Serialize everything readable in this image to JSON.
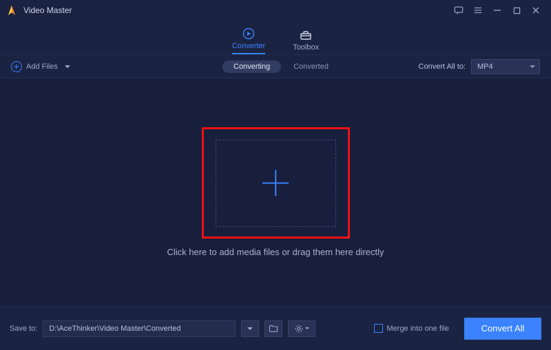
{
  "app": {
    "name": "Video Master"
  },
  "tabs": {
    "converter": "Converter",
    "toolbox": "Toolbox"
  },
  "subbar": {
    "addFiles": "Add Files",
    "converting": "Converting",
    "converted": "Converted",
    "convertAllToLabel": "Convert All to:",
    "formatSelected": "MP4"
  },
  "stage": {
    "hint": "Click here to add media files or drag them here directly"
  },
  "footer": {
    "saveToLabel": "Save to:",
    "savePath": "D:\\AceThinker\\Video Master\\Converted",
    "mergeLabel": "Merge into one file",
    "convertAll": "Convert All"
  }
}
